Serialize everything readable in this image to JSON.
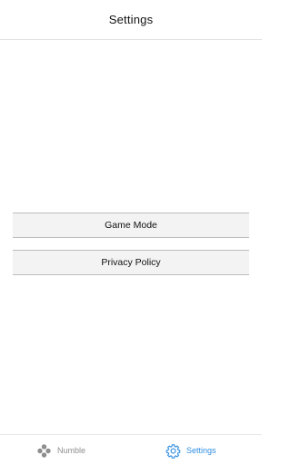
{
  "header": {
    "title": "Settings"
  },
  "menu": {
    "items": [
      {
        "label": "Game Mode"
      },
      {
        "label": "Privacy Policy"
      }
    ]
  },
  "tabbar": {
    "tabs": [
      {
        "label": "Numble",
        "icon": "gamepad-dots-icon",
        "active": false
      },
      {
        "label": "Settings",
        "icon": "gear-icon",
        "active": true
      }
    ],
    "colors": {
      "active": "#2f8ee0",
      "inactive": "#8e8e8e"
    }
  }
}
